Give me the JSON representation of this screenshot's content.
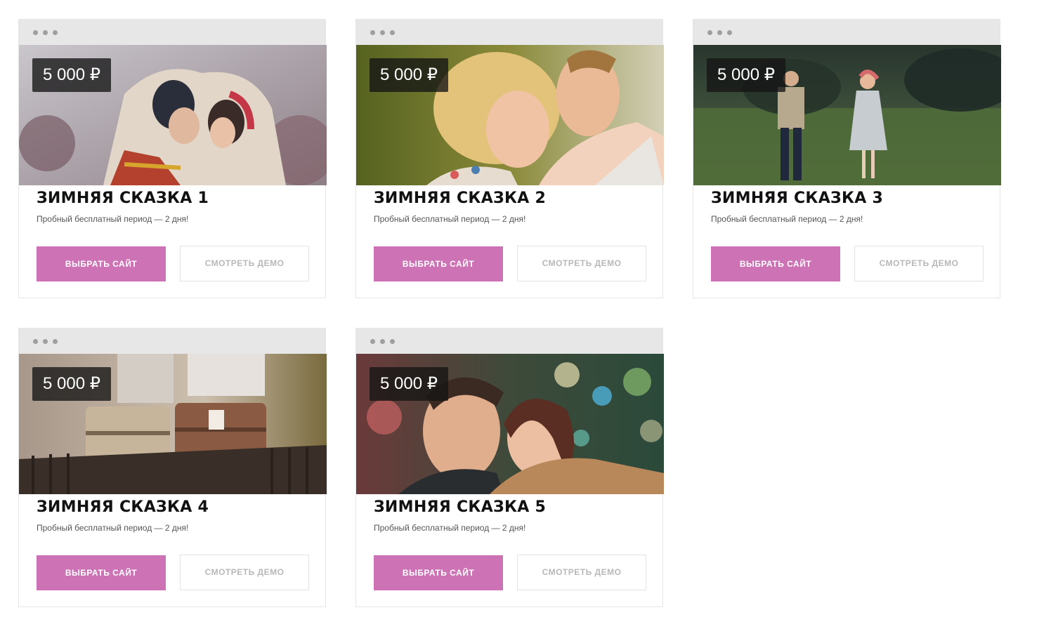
{
  "cards": [
    {
      "price": "5 000 ₽",
      "title": "ЗИМНЯЯ СКАЗКА 1",
      "subtitle": "Пробный бесплатный период — 2 дня!",
      "choose_label": "ВЫБРАТЬ САЙТ",
      "demo_label": "СМОТРЕТЬ ДЕМО"
    },
    {
      "price": "5 000 ₽",
      "title": "ЗИМНЯЯ СКАЗКА 2",
      "subtitle": "Пробный бесплатный период — 2 дня!",
      "choose_label": "ВЫБРАТЬ САЙТ",
      "demo_label": "СМОТРЕТЬ ДЕМО"
    },
    {
      "price": "5 000 ₽",
      "title": "ЗИМНЯЯ СКАЗКА 3",
      "subtitle": "Пробный бесплатный период — 2 дня!",
      "choose_label": "ВЫБРАТЬ САЙТ",
      "demo_label": "СМОТРЕТЬ ДЕМО"
    },
    {
      "price": "5 000 ₽",
      "title": "ЗИМНЯЯ СКАЗКА 4",
      "subtitle": "Пробный бесплатный период — 2 дня!",
      "choose_label": "ВЫБРАТЬ САЙТ",
      "demo_label": "СМОТРЕТЬ ДЕМО"
    },
    {
      "price": "5 000 ₽",
      "title": "ЗИМНЯЯ СКАЗКА 5",
      "subtitle": "Пробный бесплатный период — 2 дня!",
      "choose_label": "ВЫБРАТЬ САЙТ",
      "demo_label": "СМОТРЕТЬ ДЕМО"
    }
  ],
  "colors": {
    "accent": "#cd72b4",
    "titlebar": "#e7e7e7",
    "demo_text": "#b8b8b8"
  }
}
